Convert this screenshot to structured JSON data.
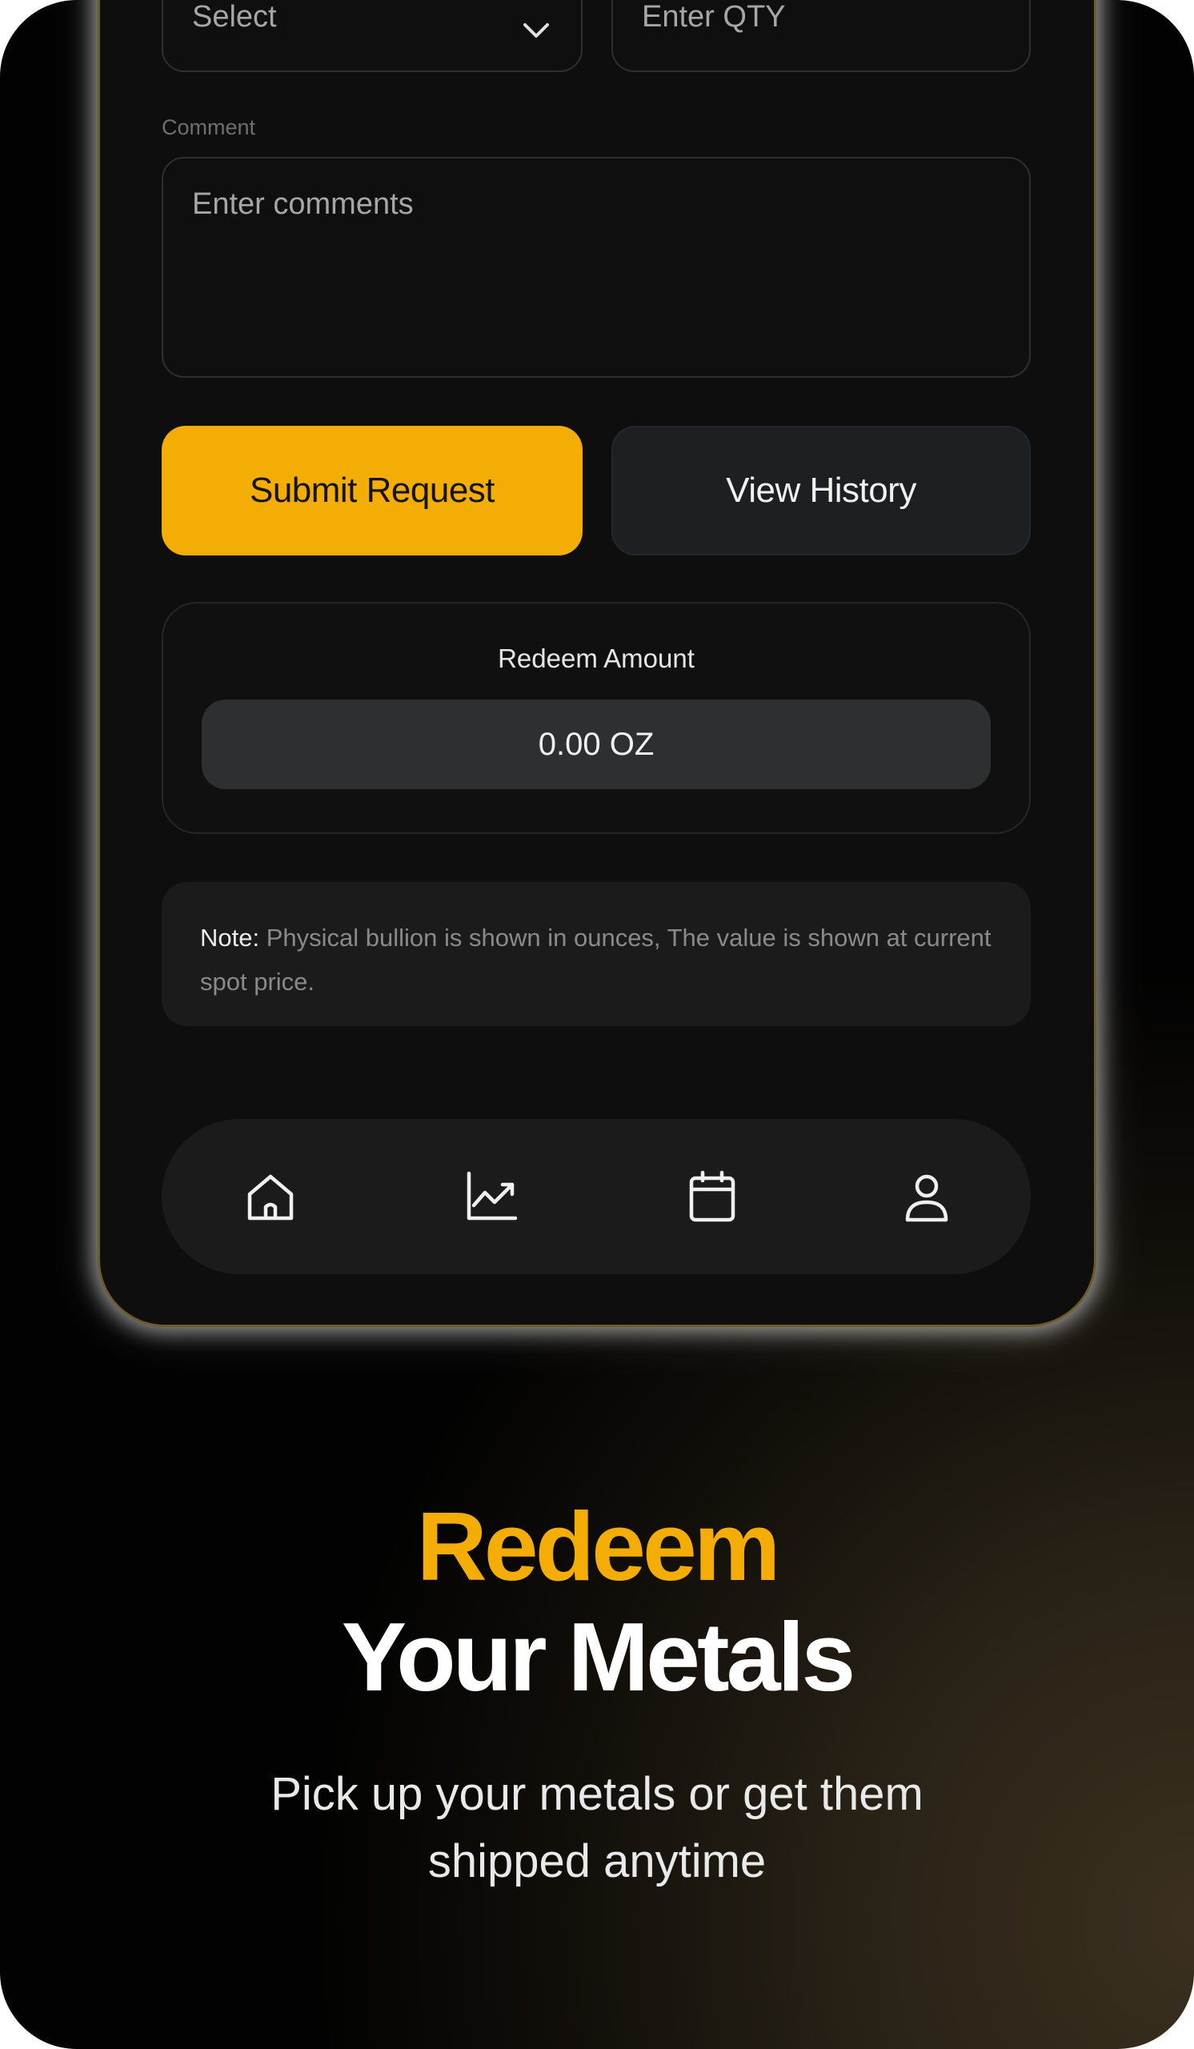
{
  "form": {
    "select_placeholder": "Select",
    "qty_placeholder": "Enter QTY",
    "comment_label": "Comment",
    "comment_placeholder": "Enter comments"
  },
  "actions": {
    "submit_label": "Submit Request",
    "history_label": "View History"
  },
  "redeem": {
    "title": "Redeem Amount",
    "amount": "0.00 OZ"
  },
  "note": {
    "prefix": "Note:",
    "text": " Physical bullion is shown in ounces, The value is shown at current spot price."
  },
  "nav": {
    "items": [
      {
        "icon": "home-icon"
      },
      {
        "icon": "chart-icon"
      },
      {
        "icon": "calendar-icon"
      },
      {
        "icon": "profile-icon"
      }
    ]
  },
  "promo": {
    "headline_accent": "Redeem",
    "headline_main": "Your Metals",
    "subtitle": "Pick up your metals or get them shipped anytime"
  },
  "colors": {
    "accent": "#f4ad04",
    "background": "#0e0e0e",
    "phone_border": "#6e5a2a"
  }
}
